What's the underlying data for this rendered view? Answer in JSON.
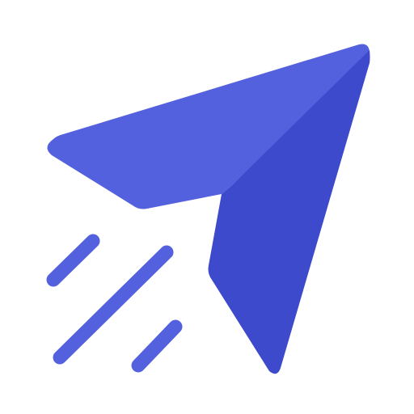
{
  "icon": {
    "name": "send-paper-plane-icon",
    "colors": {
      "primary": "#5461DE",
      "shade": "#3E4ACC",
      "background": "#FFFFFF"
    }
  }
}
